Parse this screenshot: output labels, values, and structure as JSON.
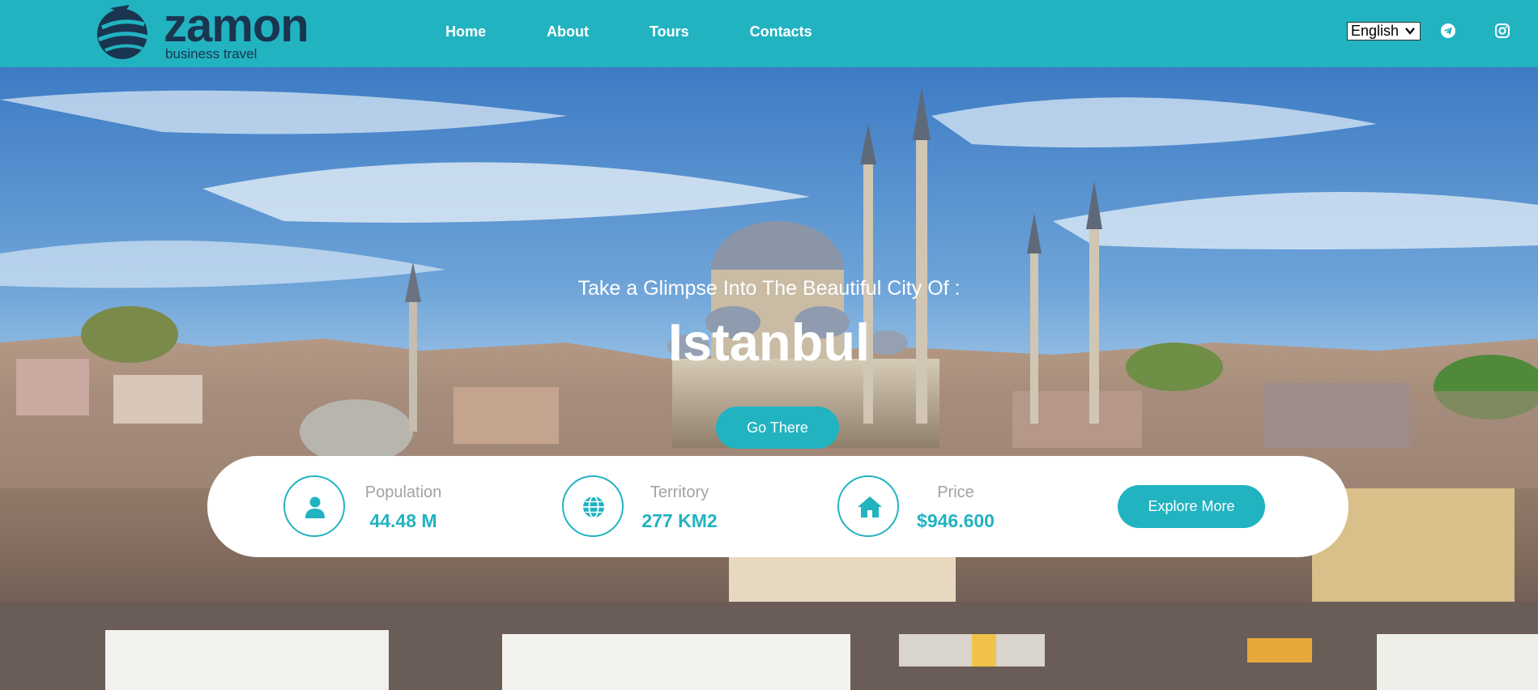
{
  "brand": {
    "name": "zamon",
    "tagline": "business travel",
    "colors": {
      "accent": "#22b3c1",
      "logo_dark": "#1a3550"
    }
  },
  "nav": {
    "items": [
      {
        "label": "Home"
      },
      {
        "label": "About"
      },
      {
        "label": "Tours"
      },
      {
        "label": "Contacts"
      }
    ]
  },
  "language": {
    "selected": "English"
  },
  "social": {
    "icons": [
      "telegram-icon",
      "instagram-icon"
    ]
  },
  "hero": {
    "subtitle": "Take a Glimpse Into The Beautiful City Of :",
    "title": "Istanbul",
    "cta": "Go There"
  },
  "stats": {
    "items": [
      {
        "icon": "user-icon",
        "label": "Population",
        "value": "44.48 M"
      },
      {
        "icon": "globe-icon",
        "label": "Territory",
        "value": "277 KM2"
      },
      {
        "icon": "home-icon",
        "label": "Price",
        "value": "$946.600"
      }
    ],
    "cta": "Explore More"
  }
}
